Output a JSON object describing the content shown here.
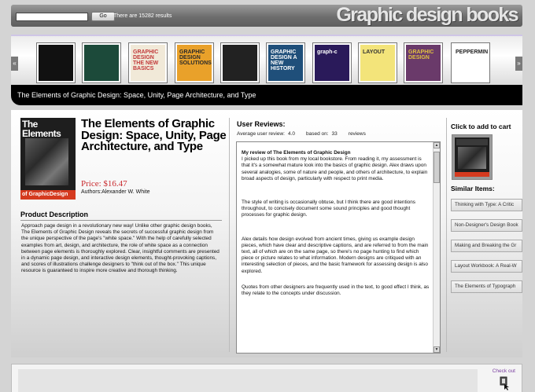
{
  "header": {
    "search_placeholder": "",
    "go_label": "Go",
    "results_text": "There are 15282 results",
    "site_title": "Graphic design books"
  },
  "carousel": {
    "prev_label": "«",
    "next_label": "»",
    "thumbs": [
      {
        "label": "",
        "bg": "#111111",
        "fg": "#ffffff"
      },
      {
        "label": "",
        "bg": "#1c4a3a",
        "fg": "#9fe0c0"
      },
      {
        "label": "GRAPHIC DESIGN THE NEW BASICS",
        "bg": "#f1e9d8",
        "fg": "#c23a3a"
      },
      {
        "label": "GRAPHIC DESIGN SOLUTIONS",
        "bg": "#e9a12a",
        "fg": "#2a2a2a"
      },
      {
        "label": "",
        "bg": "#222222",
        "fg": "#ffffff"
      },
      {
        "label": "GRAPHIC DESIGN A NEW HISTORY",
        "bg": "#1f4f7a",
        "fg": "#ffffff"
      },
      {
        "label": "graph-c",
        "bg": "#2a1a5a",
        "fg": "#ffffff"
      },
      {
        "label": "LAYOUT",
        "bg": "#f3e47a",
        "fg": "#333333"
      },
      {
        "label": "GRAPHIC DESIGN",
        "bg": "#6a3a6a",
        "fg": "#e0c040"
      },
      {
        "label": "PEPPERMINT",
        "bg": "#ffffff",
        "fg": "#222222"
      }
    ],
    "selected_title": "The Elements of Graphic Design: Space, Unity, Page Architecture, and Type"
  },
  "book": {
    "cover_title": "The Elements",
    "cover_bottom": "of GraphicDesign",
    "title": "The Elements of Graphic Design: Space, Unity, Page Architecture, and Type",
    "price": "Price: $16.47",
    "authors": "Authors:Alexander W. White",
    "description_heading": "Product Description",
    "description": "Approach page design in a revolutionary new way! Unlike other graphic design books, The Elements of Graphic Design reveals the secrets of successful graphic design from the unique perspective of the page's \"white space.\" With the help of carefully selected examples from art, design, and architecture, the role of white space as a connection between page elements is thoroughly explored. Clear, insightful comments are presented in a dynamic page design, and interactive design elements, thought-provoking captions, and scores of illustrations challenge designers to \"think out of the box.\" This unique resource is guaranteed to inspire more creative and thorough thinking."
  },
  "reviews": {
    "heading": "User Reviews:",
    "avg_label": "Average user review:",
    "avg_value": "4.0",
    "based_label": "based on:",
    "based_value": "33",
    "reviews_label": "reviews",
    "review_title": "My review of The Elements of Graphic Design",
    "paragraphs": [
      "I picked up this book from my local bookstore. From reading it, my assessment is that it's a somewhat mature look into the basics of graphic design. Alex draws upon several analogies, some of nature and people, and others of architecture, to explain broad aspects of design, particularly with respect to print media.",
      "The style of writing is occasionally obtuse, but I think there are good intentions throughout, to concisely document some sound principles and good thought processes for graphic design.",
      "Alex details how design evolved from ancient times, giving us example design pieces, which have clear and descriptive captions, and are referred to from the main text, all of which are on the same page, so there's no page hunting to find which piece or picture relates to what information. Modern designs are critiqued with an interesting selection of pieces, and the basic framework for assessing design is also explored.",
      "Quotes from other designers are frequently used in the text, to good effect I think, as they relate to the concepts under discussion."
    ]
  },
  "sidebar": {
    "cart_heading": "Click to add to cart",
    "similar_heading": "Similar Items:",
    "similar_items": [
      "Thinking with Type: A Critic",
      "Non-Designer's Design Book",
      "Making and Breaking the Gr",
      "Layout Workbook: A Real-W",
      "The Elements of Typograph"
    ]
  },
  "footer": {
    "checkout_label": "Check out"
  }
}
